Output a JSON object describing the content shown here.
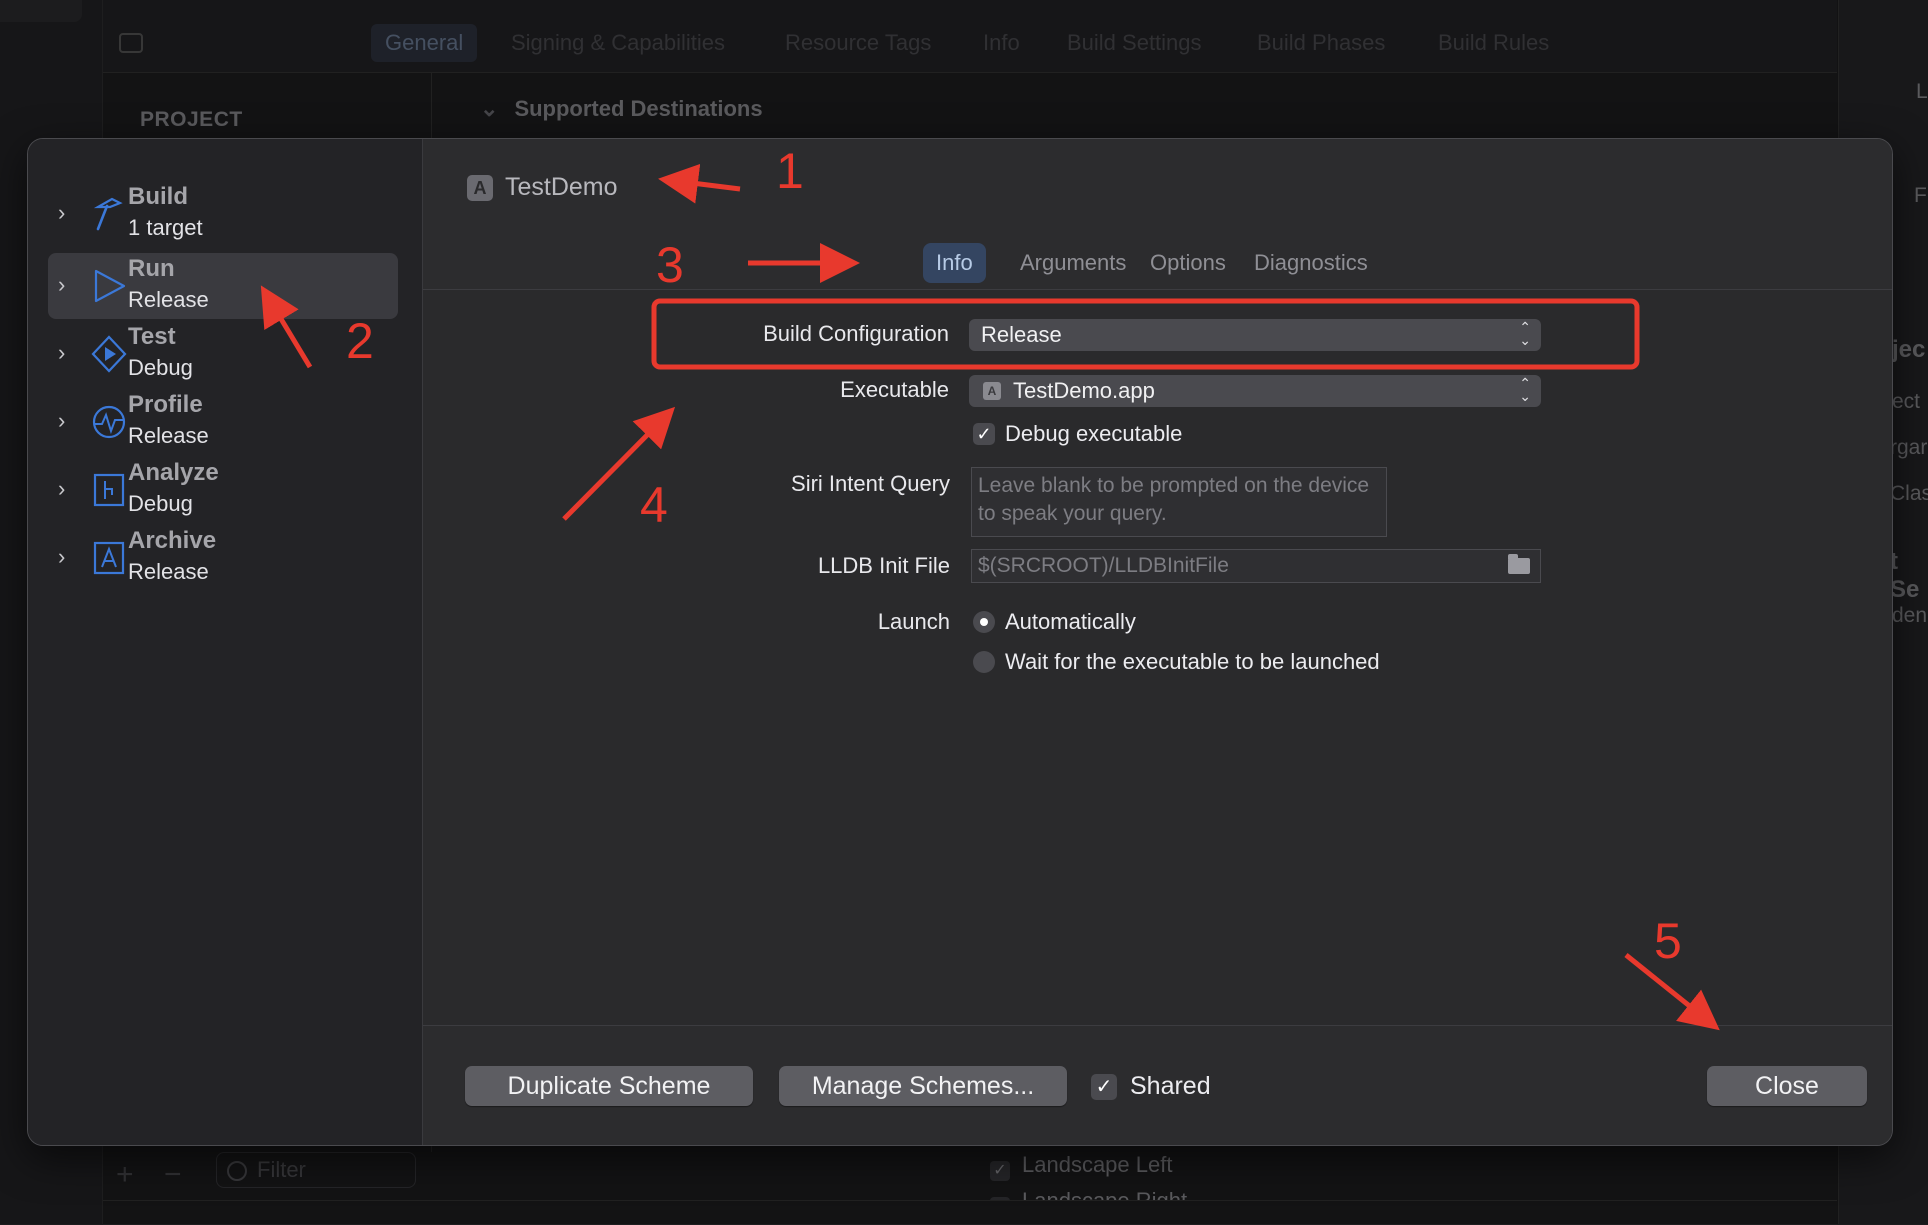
{
  "background": {
    "tabs": [
      "General",
      "Signing & Capabilities",
      "Resource Tags",
      "Info",
      "Build Settings",
      "Build Phases",
      "Build Rules"
    ],
    "active_tab": "General",
    "project_label": "PROJECT",
    "section_title": "Supported Destinations",
    "filter_placeholder": "Filter",
    "orientation_rows": [
      "Landscape Left",
      "Landscape Right"
    ],
    "right_fragments": [
      "L",
      "F",
      "jec",
      "ect",
      "rgar",
      "Class",
      "t Se",
      "den"
    ]
  },
  "sheet": {
    "actions": [
      {
        "name": "Build",
        "sub": "1 target",
        "icon": "hammer-icon"
      },
      {
        "name": "Run",
        "sub": "Release",
        "icon": "play-icon"
      },
      {
        "name": "Test",
        "sub": "Debug",
        "icon": "diamond-play-icon"
      },
      {
        "name": "Profile",
        "sub": "Release",
        "icon": "gauge-icon"
      },
      {
        "name": "Analyze",
        "sub": "Debug",
        "icon": "analyze-icon"
      },
      {
        "name": "Archive",
        "sub": "Release",
        "icon": "archive-icon"
      }
    ],
    "selected_action": "Run",
    "target_name": "TestDemo",
    "tabs": [
      "Info",
      "Arguments",
      "Options",
      "Diagnostics"
    ],
    "active_tab": "Info",
    "form": {
      "build_config_label": "Build Configuration",
      "build_config_value": "Release",
      "executable_label": "Executable",
      "executable_value": "TestDemo.app",
      "debug_executable_label": "Debug executable",
      "debug_executable_checked": true,
      "siri_label": "Siri Intent Query",
      "siri_placeholder": "Leave blank to be prompted on the device to speak your query.",
      "lldb_label": "LLDB Init File",
      "lldb_placeholder": "$(SRCROOT)/LLDBInitFile",
      "launch_label": "Launch",
      "launch_options": [
        "Automatically",
        "Wait for the executable to be launched"
      ],
      "launch_selected": "Automatically"
    },
    "footer": {
      "duplicate_label": "Duplicate Scheme",
      "manage_label": "Manage Schemes...",
      "shared_label": "Shared",
      "shared_checked": true,
      "close_label": "Close"
    }
  },
  "annotations": {
    "color": "#e8392d",
    "numbers": [
      "1",
      "2",
      "3",
      "4",
      "5"
    ]
  }
}
